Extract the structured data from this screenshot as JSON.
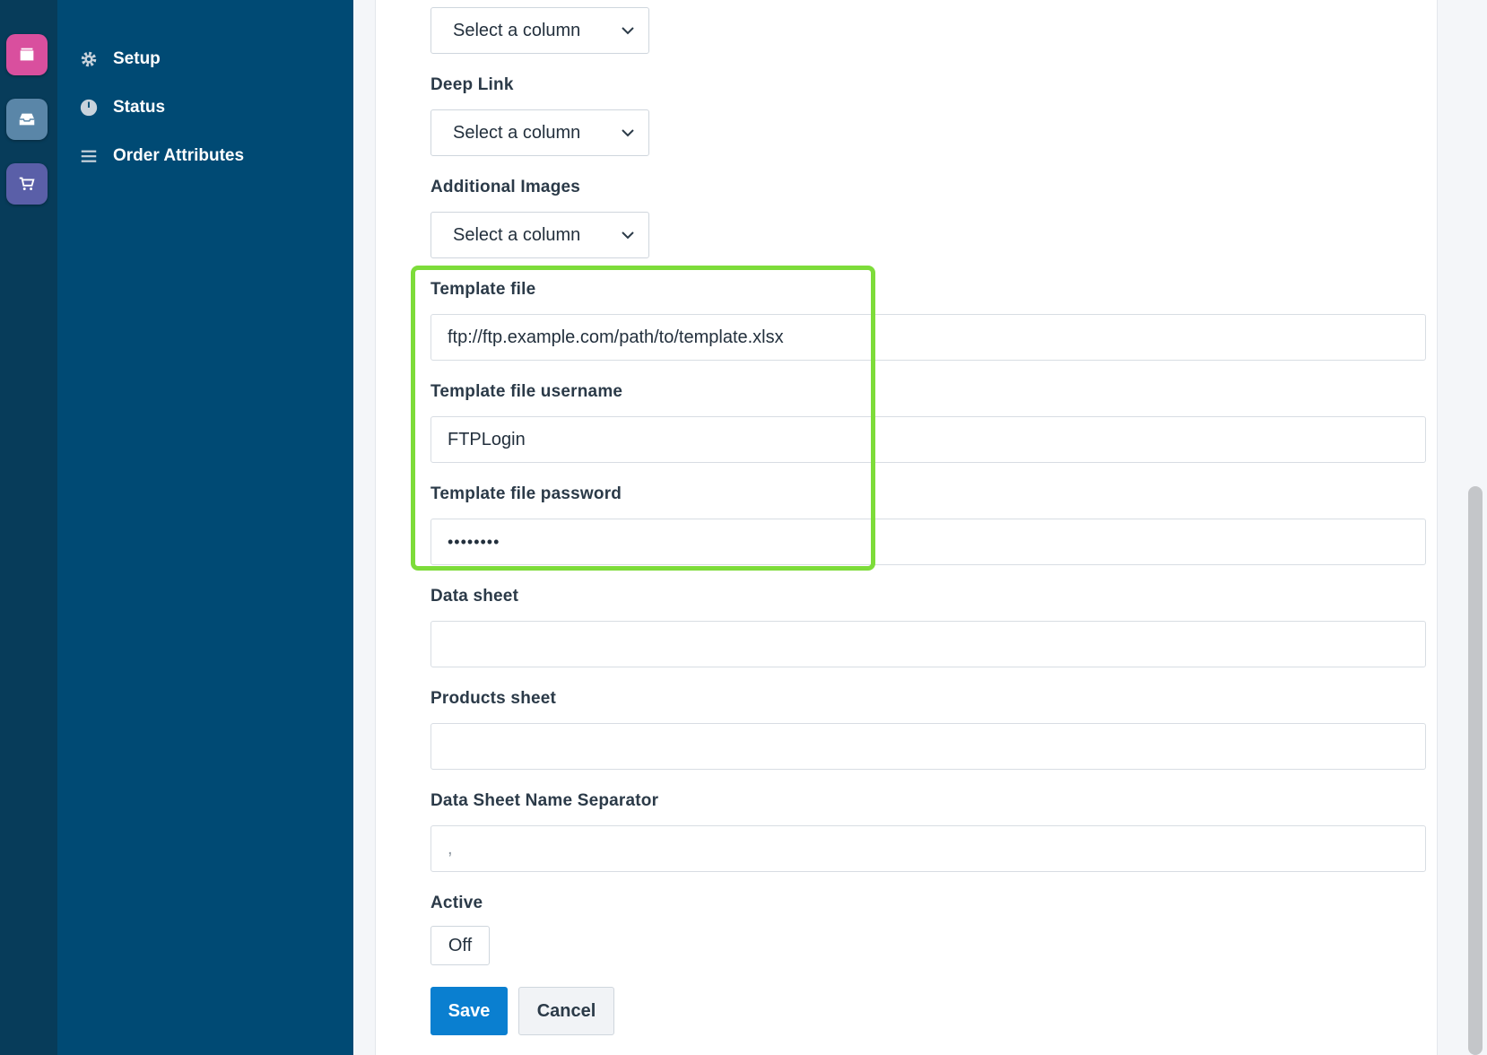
{
  "nav": {
    "items": [
      {
        "label": "Setup",
        "icon": "gear-icon"
      },
      {
        "label": "Status",
        "icon": "status-circle-icon"
      },
      {
        "label": "Order Attributes",
        "icon": "list-icon"
      }
    ]
  },
  "rail": {
    "apps": [
      {
        "icon": "folder-icon",
        "color": "#d94f9e"
      },
      {
        "icon": "inbox-icon",
        "color": "#5a86a8"
      },
      {
        "icon": "cart-icon",
        "color": "#5a5fa8"
      }
    ]
  },
  "form": {
    "select_placeholder": "Select a column",
    "deep_link_label": "Deep Link",
    "additional_images_label": "Additional Images",
    "template_file_label": "Template file",
    "template_file_value": "ftp://ftp.example.com/path/to/template.xlsx",
    "template_username_label": "Template file username",
    "template_username_value": "FTPLogin",
    "template_password_label": "Template file password",
    "template_password_value": "••••••••",
    "data_sheet_label": "Data sheet",
    "data_sheet_value": "",
    "products_sheet_label": "Products sheet",
    "products_sheet_value": "",
    "separator_label": "Data Sheet Name Separator",
    "separator_value": ",",
    "active_label": "Active",
    "active_value": "Off",
    "save_label": "Save",
    "cancel_label": "Cancel"
  },
  "colors": {
    "highlight": "#7ddc3a",
    "primary": "#0a7fd0",
    "sidebar": "#004a74"
  }
}
